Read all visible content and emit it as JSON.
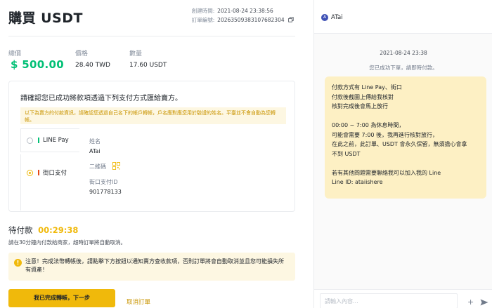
{
  "order": {
    "title": "購買 USDT",
    "created_label": "創建時間:",
    "created_value": "2021-08-24 23:38:56",
    "number_label": "訂單編號:",
    "number_value": "20263509383107682304"
  },
  "stats": {
    "total_label": "總價",
    "total_value": "$ 500.00",
    "price_label": "價格",
    "price_value": "28.40 TWD",
    "qty_label": "數量",
    "qty_value": "17.60 USDT"
  },
  "payment": {
    "heading": "請確認您已成功將款項透過下列支付方式匯給賣方。",
    "notice": "以下為賣方的付款資訊，請確認您透過自己名下的帳戶轉帳，戶名應對應您用於驗證的姓名。平臺並不會自動為您轉帳。",
    "methods": [
      {
        "label": "LINE Pay",
        "color": "#02c076",
        "selected": false
      },
      {
        "label": "街口支付",
        "color": "#e64a19",
        "selected": true
      }
    ],
    "name_label": "姓名",
    "name_value": "ATai",
    "qr_label": "二維碼",
    "id_label": "街口支付ID",
    "id_value": "901778133"
  },
  "pending": {
    "label": "待付款",
    "timer": "00:29:38",
    "subtext": "請在30分鐘內付款給商家，超時訂單將自動取消。"
  },
  "warning": {
    "text": "注意！完成法幣轉帳後，請點擊下方按鈕以通知賣方查收款項，否則訂單將會自動取消並且您可能損失所有資產！"
  },
  "actions": {
    "confirm": "我已完成轉帳，下一步",
    "cancel": "取消訂單"
  },
  "chat": {
    "avatar": "A",
    "name": "ATai",
    "time": "2021-08-24 23:38",
    "system": "您已成功下單，請即時付款。",
    "lines": [
      "付款方式有 Line Pay、街口",
      "付款後截圖上傳給我核對",
      "核對完成後會馬上放行",
      "",
      "00:00 ~ 7:00 為休息時間，",
      "可能會需要 7:00 後，我再進行核對放行，",
      "在此之前，此訂單、USDT 會永久保留，無須擔心會拿",
      "不到 USDT",
      "",
      "若有其他問題需要聯絡我可以加入我的 Line",
      "Line ID: ataiishere"
    ],
    "input_placeholder": "請輸入內容...",
    "plus": "+"
  },
  "colors": {
    "accent": "#f0b90b",
    "positive": "#02c076"
  }
}
